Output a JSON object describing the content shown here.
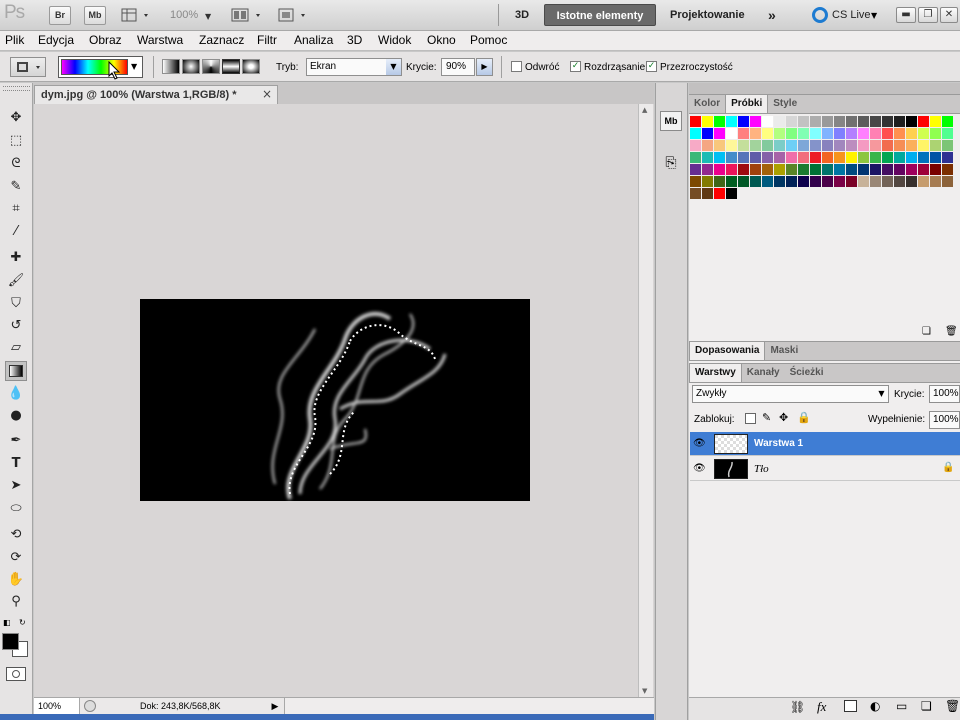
{
  "app": {
    "logo": "Ps",
    "bridge": "Br",
    "minibridge": "Mb",
    "zoom": "100%"
  },
  "workspaces": {
    "w3d": "3D",
    "essentials": "Istotne elementy",
    "design": "Projektowanie",
    "more": "»",
    "cslive": "CS Live"
  },
  "menu": [
    "Plik",
    "Edycja",
    "Obraz",
    "Warstwa",
    "Zaznacz",
    "Filtr",
    "Analiza",
    "3D",
    "Widok",
    "Okno",
    "Pomoc"
  ],
  "options": {
    "mode_label": "Tryb:",
    "mode_value": "Ekran",
    "opacity_label": "Krycie:",
    "opacity_value": "90%",
    "reverse": "Odwróć",
    "dither": "Rozdrząsanie",
    "transparency": "Przezroczystość"
  },
  "document": {
    "tab_title": "dym.jpg @ 100% (Warstwa 1,RGB/8) *",
    "close": "×",
    "zoom": "100%",
    "doc_info": "Dok: 243,8K/568,8K"
  },
  "panel_top": {
    "tabs": [
      "Kolor",
      "Próbki",
      "Style"
    ],
    "active": 1
  },
  "swatch_colors": [
    "#ff0000",
    "#ffff00",
    "#00ff00",
    "#00ffff",
    "#0000ff",
    "#ff00ff",
    "#ffffff",
    "#ebebeb",
    "#d6d6d6",
    "#c2c2c2",
    "#adadad",
    "#999999",
    "#858585",
    "#707070",
    "#5c5c5c",
    "#474747",
    "#333333",
    "#1f1f1f",
    "#000000",
    "#ff0000",
    "#ffff00",
    "#00ff00",
    "#00ffff",
    "#0000ff",
    "#ff00ff",
    "#ffffff",
    "#ff8080",
    "#ffb380",
    "#ffff80",
    "#b3ff80",
    "#80ff80",
    "#80ffb3",
    "#80ffff",
    "#80b3ff",
    "#8080ff",
    "#b380ff",
    "#ff80ff",
    "#ff80b3",
    "#ff5050",
    "#ff9050",
    "#ffd050",
    "#d0ff50",
    "#90ff50",
    "#50ff90",
    "#f7aac6",
    "#f5a683",
    "#f8c77c",
    "#fff79a",
    "#c4df9b",
    "#a2d39c",
    "#82ca9d",
    "#7bcdc8",
    "#6ecff6",
    "#7ea7d8",
    "#8493ca",
    "#8882be",
    "#a187be",
    "#bc8dbf",
    "#f49ac2",
    "#f6989d",
    "#f26c4f",
    "#f68e55",
    "#fbaf5c",
    "#fff467",
    "#acd372",
    "#7cc576",
    "#3bb878",
    "#1bbbb4",
    "#00bff3",
    "#438cca",
    "#5574b9",
    "#605ca8",
    "#8560a8",
    "#a763a8",
    "#f06eaa",
    "#f26d7d",
    "#ed1c24",
    "#f26522",
    "#f7941d",
    "#fff200",
    "#8dc63f",
    "#39b54a",
    "#00a651",
    "#00a99d",
    "#00aeef",
    "#0072bc",
    "#0054a6",
    "#2e3192",
    "#662d91",
    "#92278f",
    "#ec008c",
    "#ed145b",
    "#9e0b0f",
    "#a0410d",
    "#a3620a",
    "#aba000",
    "#598527",
    "#1a7b30",
    "#007236",
    "#00746b",
    "#0076a3",
    "#004b80",
    "#003471",
    "#1b1464",
    "#440e62",
    "#630460",
    "#9e005d",
    "#9e0039",
    "#790000",
    "#7b2e00",
    "#7d4900",
    "#827b00",
    "#406618",
    "#005e20",
    "#005826",
    "#005952",
    "#005b7f",
    "#003663",
    "#002157",
    "#0d004c",
    "#32004b",
    "#4b0049",
    "#7b0046",
    "#7a0026",
    "#c7b299",
    "#998675",
    "#736357",
    "#534741",
    "#37302d",
    "#c69c6d",
    "#a67c52",
    "#8c6239",
    "#754c24",
    "#603913",
    "#ff0000",
    "#000000"
  ],
  "panel_mid": {
    "tabs": [
      "Dopasowania",
      "Maski"
    ],
    "active": 0
  },
  "layers": {
    "tabs": [
      "Warstwy",
      "Kanały",
      "Ścieżki"
    ],
    "active": 0,
    "blend": "Zwykły",
    "opacity_label": "Krycie:",
    "opacity_value": "100%",
    "lock_label": "Zablokuj:",
    "fill_label": "Wypełnienie:",
    "fill_value": "100%",
    "items": [
      {
        "name": "Warstwa 1",
        "selected": true
      },
      {
        "name": "Tło",
        "locked": true
      }
    ]
  }
}
